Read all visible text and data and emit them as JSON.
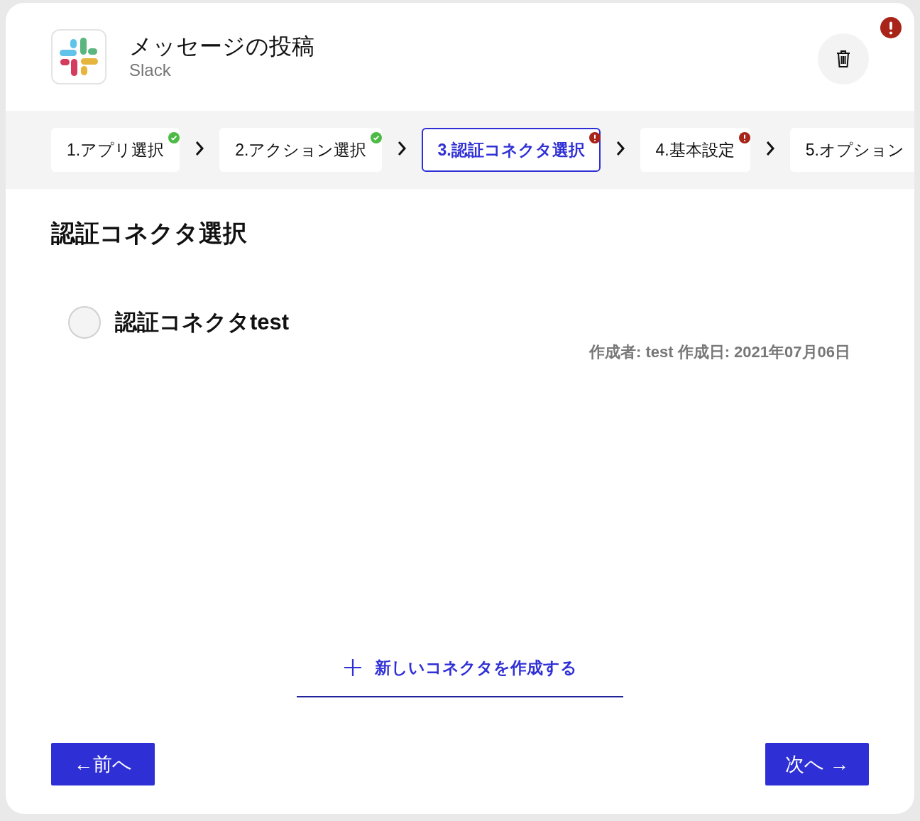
{
  "app": {
    "title": "メッセージの投稿",
    "subtitle": "Slack",
    "alert": true
  },
  "steps": [
    {
      "label": "1.アプリ選択",
      "done": true,
      "error": false,
      "selected": false
    },
    {
      "label": "2.アクション選択",
      "done": true,
      "error": false,
      "selected": false
    },
    {
      "label": "3.認証コネクタ選択",
      "done": false,
      "error": true,
      "selected": true
    },
    {
      "label": "4.基本設定",
      "done": false,
      "error": true,
      "selected": false
    },
    {
      "label": "5.オプション",
      "done": false,
      "error": false,
      "selected": false
    }
  ],
  "section_title": "認証コネクタ選択",
  "connectors": [
    {
      "name": "認証コネクタtest",
      "meta": "作成者: test 作成日: 2021年07月06日",
      "selected": false
    }
  ],
  "create_link": "新しいコネクタを作成する",
  "buttons": [
    "←前へ",
    "次へ →"
  ]
}
